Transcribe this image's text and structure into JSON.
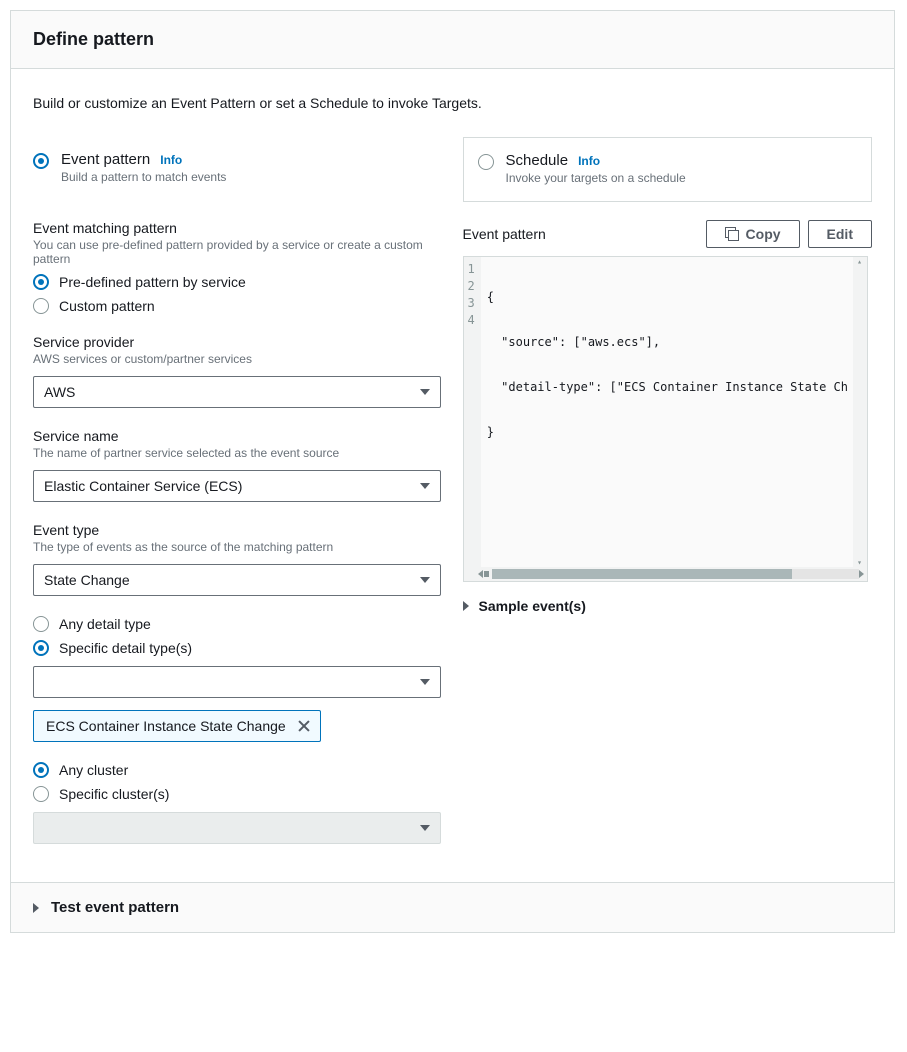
{
  "header": {
    "title": "Define pattern"
  },
  "description": "Build or customize an Event Pattern or set a Schedule to invoke Targets.",
  "options": {
    "event_pattern": {
      "title": "Event pattern",
      "info": "Info",
      "sub": "Build a pattern to match events",
      "selected": true
    },
    "schedule": {
      "title": "Schedule",
      "info": "Info",
      "sub": "Invoke your targets on a schedule",
      "selected": false
    }
  },
  "matching": {
    "title": "Event matching pattern",
    "help": "You can use pre-defined pattern provided by a service or create a custom pattern",
    "predef_label": "Pre-defined pattern by service",
    "custom_label": "Custom pattern",
    "selected": "predef"
  },
  "provider": {
    "title": "Service provider",
    "help": "AWS services or custom/partner services",
    "value": "AWS"
  },
  "service_name": {
    "title": "Service name",
    "help": "The name of partner service selected as the event source",
    "value": "Elastic Container Service (ECS)"
  },
  "event_type": {
    "title": "Event type",
    "help": "The type of events as the source of the matching pattern",
    "value": "State Change"
  },
  "detail_type": {
    "any_label": "Any detail type",
    "specific_label": "Specific detail type(s)",
    "selected": "specific",
    "dropdown_value": "",
    "token": "ECS Container Instance State Change"
  },
  "cluster": {
    "any_label": "Any cluster",
    "specific_label": "Specific cluster(s)",
    "selected": "any"
  },
  "right": {
    "title": "Event pattern",
    "copy": "Copy",
    "edit": "Edit",
    "lines": {
      "l1": "1",
      "l2": "2",
      "l3": "3",
      "l4": "4",
      "c1": "{",
      "c2": "  \"source\": [\"aws.ecs\"],",
      "c3": "  \"detail-type\": [\"ECS Container Instance State Ch",
      "c4": "}"
    },
    "sample": "Sample event(s)"
  },
  "footer": {
    "label": "Test event pattern"
  }
}
